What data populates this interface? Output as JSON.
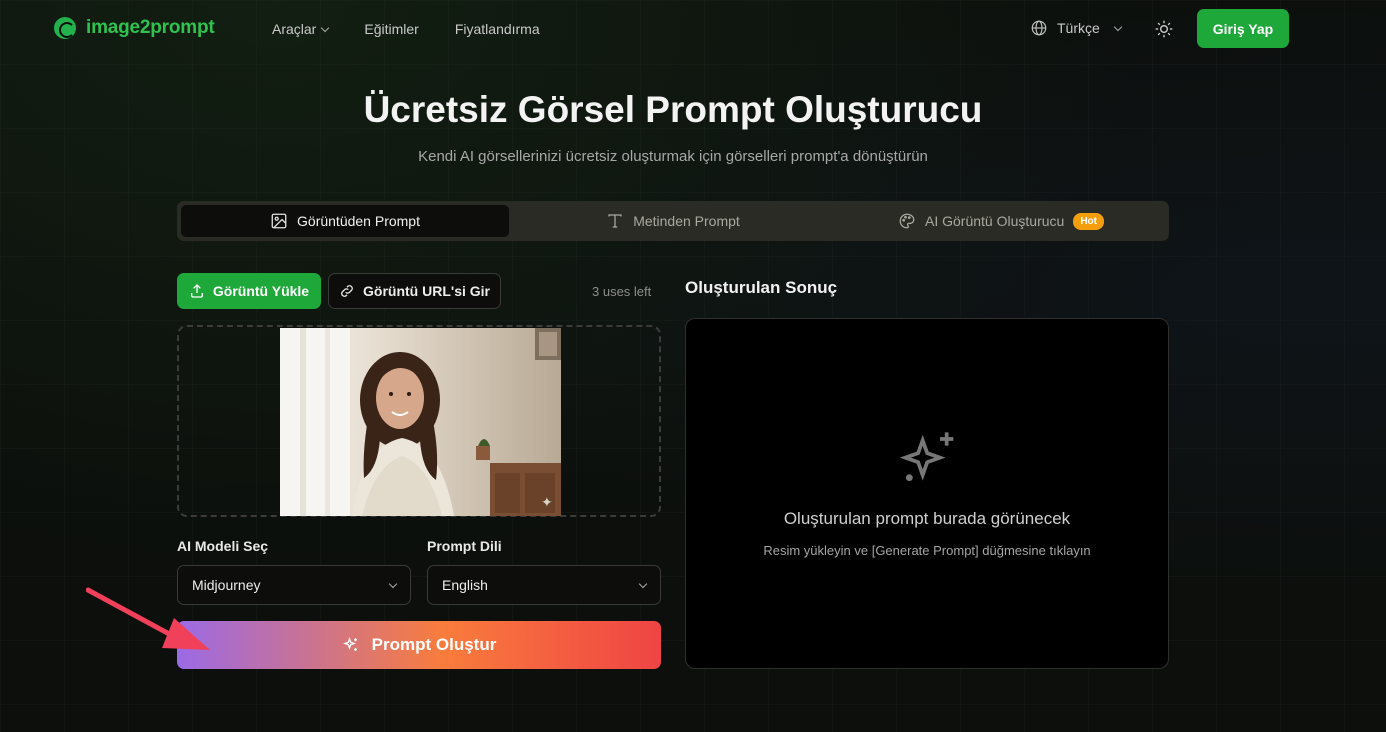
{
  "header": {
    "logo_text": "image2prompt",
    "nav": [
      {
        "label": "Araçlar",
        "has_dropdown": true
      },
      {
        "label": "Eğitimler",
        "has_dropdown": false
      },
      {
        "label": "Fiyatlandırma",
        "has_dropdown": false
      }
    ],
    "language": "Türkçe",
    "login_label": "Giriş Yap"
  },
  "hero": {
    "title": "Ücretsiz Görsel Prompt Oluşturucu",
    "subtitle": "Kendi AI görsellerinizi ücretsiz oluşturmak için görselleri prompt'a dönüştürün"
  },
  "tabs": [
    {
      "label": "Görüntüden Prompt",
      "icon": "image-icon",
      "active": true
    },
    {
      "label": "Metinden Prompt",
      "icon": "text-icon",
      "active": false
    },
    {
      "label": "AI Görüntü Oluşturucu",
      "icon": "palette-icon",
      "active": false,
      "badge": "Hot"
    }
  ],
  "upload": {
    "upload_label": "Görüntü Yükle",
    "url_label": "Görüntü URL'si Gir",
    "uses_left": "3 uses left"
  },
  "model_select": {
    "label": "AI Modeli Seç",
    "value": "Midjourney"
  },
  "language_select": {
    "label": "Prompt Dili",
    "value": "English"
  },
  "generate_label": "Prompt Oluştur",
  "result": {
    "title": "Oluşturulan Sonuç",
    "placeholder": "Oluşturulan prompt burada görünecek",
    "hint": "Resim yükleyin ve [Generate Prompt] düğmesine tıklayın"
  },
  "colors": {
    "brand_green": "#1fa83a",
    "hot_badge": "#f59e0b",
    "gradient_start": "#9b6ae6",
    "gradient_end": "#ef4444",
    "annotation_arrow": "#f0405a"
  }
}
